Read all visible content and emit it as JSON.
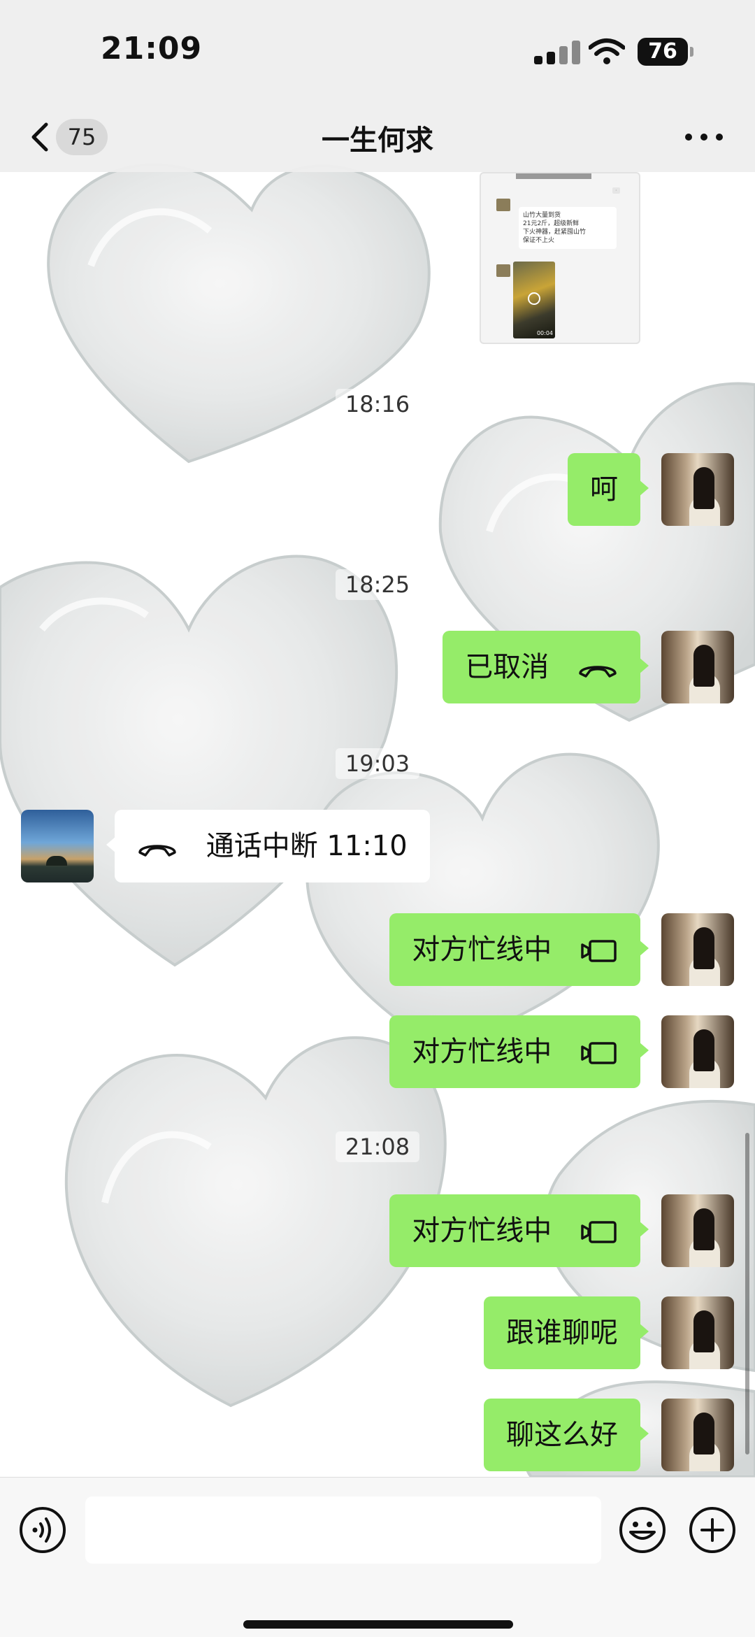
{
  "status_bar": {
    "time": "21:09",
    "battery": "76"
  },
  "header": {
    "back_count": "75",
    "title": "一生何求"
  },
  "shared_card": {
    "lines": [
      "山竹大量到货",
      "21元2斤，超级新鲜",
      "下火神器，赶紧囤山竹",
      "保证不上火"
    ],
    "video_duration": "00:04"
  },
  "messages": [
    {
      "type": "time",
      "text": "18:16"
    },
    {
      "type": "me",
      "text": "呵"
    },
    {
      "type": "time",
      "text": "18:25"
    },
    {
      "type": "me",
      "text": "已取消",
      "icon": "phone-hangup-icon"
    },
    {
      "type": "time",
      "text": "19:03"
    },
    {
      "type": "them",
      "text": "通话中断 11:10",
      "icon": "phone-hangup-icon"
    },
    {
      "type": "me",
      "text": "对方忙线中",
      "icon": "video-call-icon"
    },
    {
      "type": "me",
      "text": "对方忙线中",
      "icon": "video-call-icon"
    },
    {
      "type": "time",
      "text": "21:08"
    },
    {
      "type": "me",
      "text": "对方忙线中",
      "icon": "video-call-icon"
    },
    {
      "type": "me",
      "text": "跟谁聊呢"
    },
    {
      "type": "me",
      "text": "聊这么好"
    }
  ],
  "input": {
    "placeholder": "",
    "icons": [
      "voice-icon",
      "emoji-icon",
      "plus-icon"
    ]
  },
  "colors": {
    "my_bubble": "#95ec69",
    "their_bubble": "#ffffff",
    "header_bg": "#eeeeee"
  }
}
